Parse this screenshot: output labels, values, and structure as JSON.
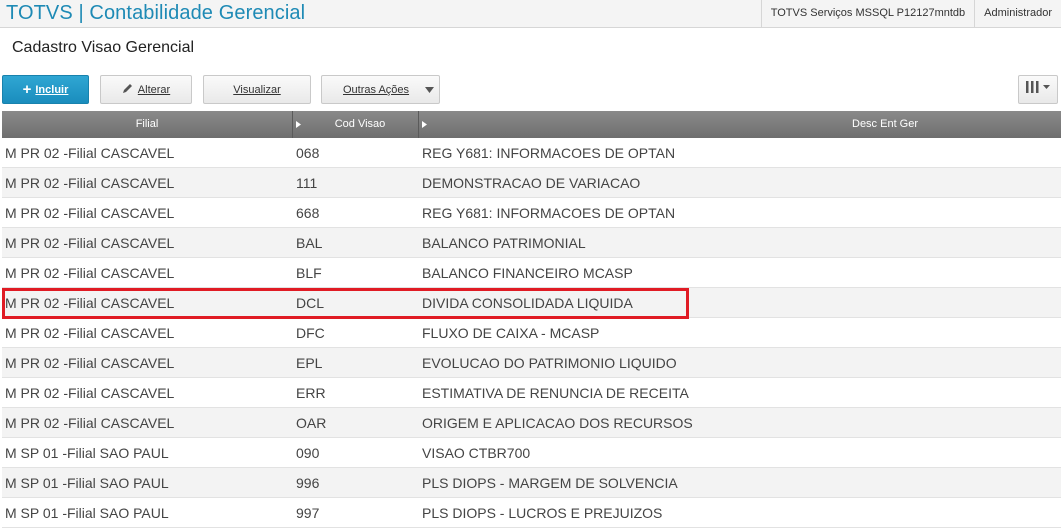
{
  "header": {
    "app_title": "TOTVS | Contabilidade Gerencial",
    "environment": "TOTVS Serviços MSSQL P12127mntdb",
    "user": "Administrador"
  },
  "page": {
    "title": "Cadastro Visao Gerencial"
  },
  "toolbar": {
    "include_label": "Incluir",
    "alter_label": "Alterar",
    "view_label": "Visualizar",
    "other_actions_label": "Outras Ações"
  },
  "table": {
    "columns": [
      "Filial",
      "Cod Visao",
      "Desc Ent Ger"
    ],
    "rows": [
      {
        "filial": "M PR 02 -Filial CASCAVEL",
        "cod": "068",
        "desc": "REG Y681: INFORMACOES DE OPTAN"
      },
      {
        "filial": "M PR 02 -Filial CASCAVEL",
        "cod": "111",
        "desc": "DEMONSTRACAO DE VARIACAO"
      },
      {
        "filial": "M PR 02 -Filial CASCAVEL",
        "cod": "668",
        "desc": "REG Y681: INFORMACOES DE OPTAN"
      },
      {
        "filial": "M PR 02 -Filial CASCAVEL",
        "cod": "BAL",
        "desc": "BALANCO PATRIMONIAL"
      },
      {
        "filial": "M PR 02 -Filial CASCAVEL",
        "cod": "BLF",
        "desc": "BALANCO FINANCEIRO MCASP"
      },
      {
        "filial": "M PR 02 -Filial CASCAVEL",
        "cod": "DCL",
        "desc": "DIVIDA CONSOLIDADA LIQUIDA"
      },
      {
        "filial": "M PR 02 -Filial CASCAVEL",
        "cod": "DFC",
        "desc": "FLUXO DE CAIXA - MCASP"
      },
      {
        "filial": "M PR 02 -Filial CASCAVEL",
        "cod": "EPL",
        "desc": "EVOLUCAO DO PATRIMONIO LIQUIDO"
      },
      {
        "filial": "M PR 02 -Filial CASCAVEL",
        "cod": "ERR",
        "desc": "ESTIMATIVA DE RENUNCIA DE RECEITA"
      },
      {
        "filial": "M PR 02 -Filial CASCAVEL",
        "cod": "OAR",
        "desc": "ORIGEM E APLICACAO DOS RECURSOS"
      },
      {
        "filial": "M SP 01 -Filial SAO PAUL",
        "cod": "090",
        "desc": "VISAO CTBR700"
      },
      {
        "filial": "M SP 01 -Filial SAO PAUL",
        "cod": "996",
        "desc": "PLS DIOPS - MARGEM DE SOLVENCIA"
      },
      {
        "filial": "M SP 01 -Filial SAO PAUL",
        "cod": "997",
        "desc": "PLS DIOPS - LUCROS E PREJUIZOS"
      }
    ]
  },
  "colors": {
    "accent": "#1e8ab5",
    "highlight": "#e01b24",
    "header_bg": "#7a7a7a"
  }
}
